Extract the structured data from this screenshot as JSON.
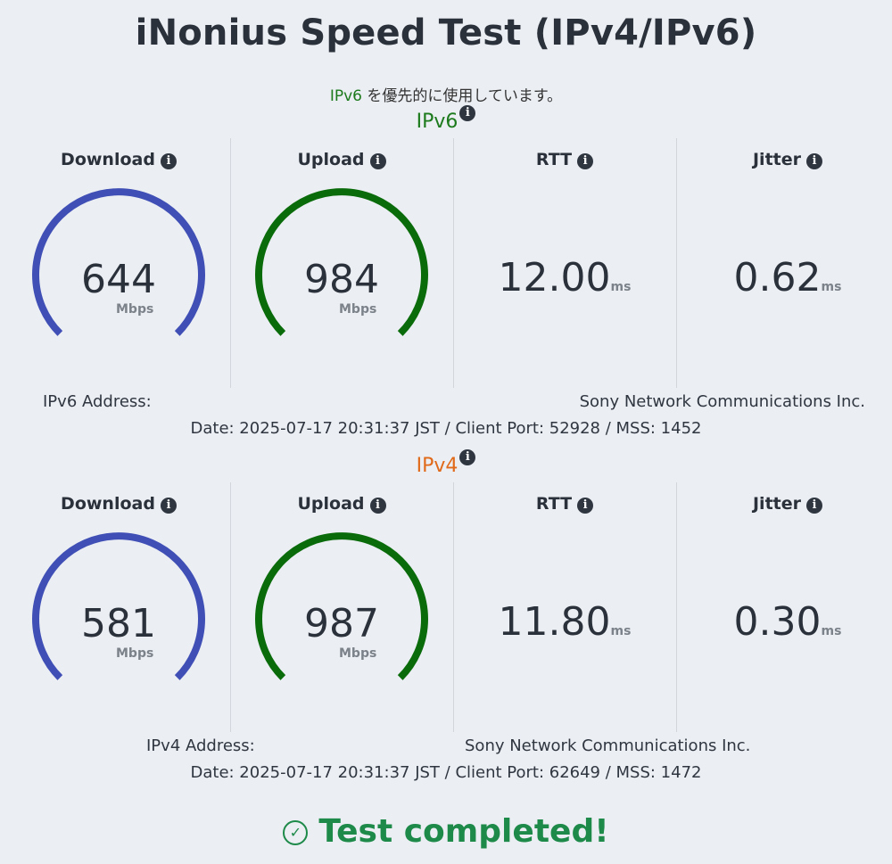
{
  "title": "iNonius Speed Test (IPv4/IPv6)",
  "preference": {
    "ipv6": "IPv6",
    "rest": " を優先的に使用しています。"
  },
  "colors": {
    "download": "#3f4fb5",
    "upload": "#0a6b0a",
    "ipv6": "#1d7a1d",
    "ipv4": "#e06a1a",
    "completed": "#1e8a4a"
  },
  "headers": {
    "download": "Download",
    "upload": "Upload",
    "rtt": "RTT",
    "jitter": "Jitter"
  },
  "units": {
    "mbps": "Mbps",
    "ms": "ms"
  },
  "ipv6": {
    "label": "IPv6",
    "download": "644",
    "upload": "984",
    "rtt": "12.00",
    "jitter": "0.62",
    "address_label": "IPv6 Address:",
    "isp": "Sony Network Communications Inc.",
    "details": "Date: 2025-07-17 20:31:37 JST / Client Port: 52928 / MSS: 1452"
  },
  "ipv4": {
    "label": "IPv4",
    "download": "581",
    "upload": "987",
    "rtt": "11.80",
    "jitter": "0.30",
    "address_label": "IPv4 Address:",
    "isp": "Sony Network Communications Inc.",
    "details": "Date: 2025-07-17 20:31:37 JST / Client Port: 62649 / MSS: 1472"
  },
  "status": {
    "icon": "check-circle-icon",
    "text": "Test completed!"
  }
}
